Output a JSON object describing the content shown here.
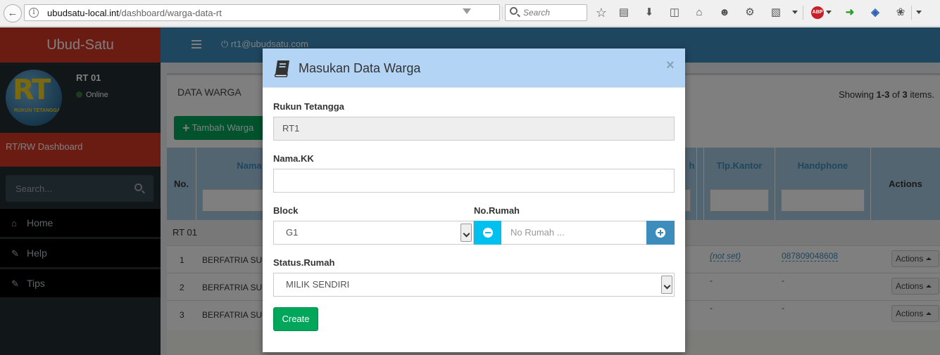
{
  "browser": {
    "url_host": "ubudsatu-local.int",
    "url_path": "/dashboard/warga-data-rt",
    "search_placeholder": "Search",
    "abp_label": "ABP",
    "icons": [
      "back-arrow-icon",
      "info-icon",
      "reload-icon",
      "search-icon",
      "star-icon",
      "reading-list-icon",
      "download-icon",
      "pocket-icon",
      "home-icon",
      "emoji-icon",
      "extension-icon",
      "clipboard-icon",
      "adblock-icon",
      "app-icon",
      "translate-icon",
      "bug-icon",
      "menu-icon"
    ]
  },
  "sidebar": {
    "logo": "Ubud-Satu",
    "avatar_big": "RT",
    "avatar_small": "RUKUN TETANGGA",
    "user_name": "RT 01",
    "user_status": "Online",
    "dashboard_link": "RT/RW Dashboard",
    "search_placeholder": "Search...",
    "menu": [
      {
        "label": "Home",
        "icon": "home-icon"
      },
      {
        "label": "Help",
        "icon": "pencil-icon"
      },
      {
        "label": "Tips",
        "icon": "pencil-icon"
      }
    ]
  },
  "topnav": {
    "user_email": "rt1@ubudsatu.com"
  },
  "panel": {
    "title": "DATA WARGA",
    "showing_prefix": "Showing ",
    "showing_range": "1-3",
    "showing_mid": " of ",
    "showing_total": "3",
    "showing_suffix": " items.",
    "add_button": "Tambah Warga",
    "columns": {
      "no": "No.",
      "nama": "Nama",
      "tlp_rumah_frag": "h",
      "tlp_kantor": "Tlp.Kantor",
      "handphone": "Handphone",
      "actions": "Actions"
    },
    "group": "RT 01",
    "rows": [
      {
        "no": "1",
        "name": "BERFATRIA SUK",
        "kantor": "(not set)",
        "hp": "087809048608",
        "action": "Actions"
      },
      {
        "no": "2",
        "name": "BERFATRIA SUK",
        "kantor": "-",
        "hp": "-",
        "action": "Actions"
      },
      {
        "no": "3",
        "name": "BERFATRIA SUK",
        "kantor": "-",
        "hp": "-",
        "action": "Actions"
      }
    ]
  },
  "modal": {
    "title": "Masukan Data Warga",
    "close": "×",
    "rt_label": "Rukun Tetangga",
    "rt_value": "RT1",
    "kk_label": "Nama.KK",
    "kk_value": "",
    "block_label": "Block",
    "block_value": "G1",
    "norumah_label": "No.Rumah",
    "norumah_placeholder": "No Rumah ...",
    "status_label": "Status.Rumah",
    "status_value": "MILIK SENDIRI",
    "create_button": "Create"
  },
  "colors": {
    "brand_red": "#d73925",
    "primary": "#3c8dbc",
    "success": "#00a65a",
    "info": "#00c0ef",
    "modal_header": "#b3d4f5"
  }
}
